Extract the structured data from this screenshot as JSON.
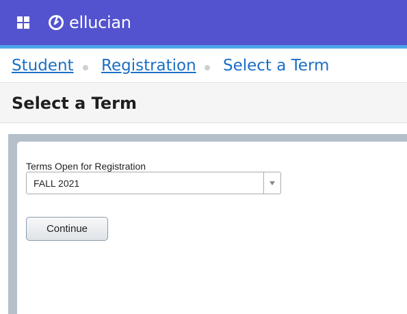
{
  "header": {
    "app_icon": "apps-grid-icon",
    "logo_icon": "ellucian-logo-icon",
    "brand": "ellucian",
    "colors": {
      "bar": "#5353d0",
      "accent": "#4da6ea"
    }
  },
  "breadcrumb": {
    "items": [
      {
        "label": "Student",
        "link": true
      },
      {
        "label": "Registration",
        "link": true
      },
      {
        "label": "Select a Term",
        "link": false
      }
    ]
  },
  "page": {
    "title": "Select a Term"
  },
  "form": {
    "term_label": "Terms Open for Registration",
    "term_value": "FALL 2021",
    "continue_label": "Continue"
  }
}
